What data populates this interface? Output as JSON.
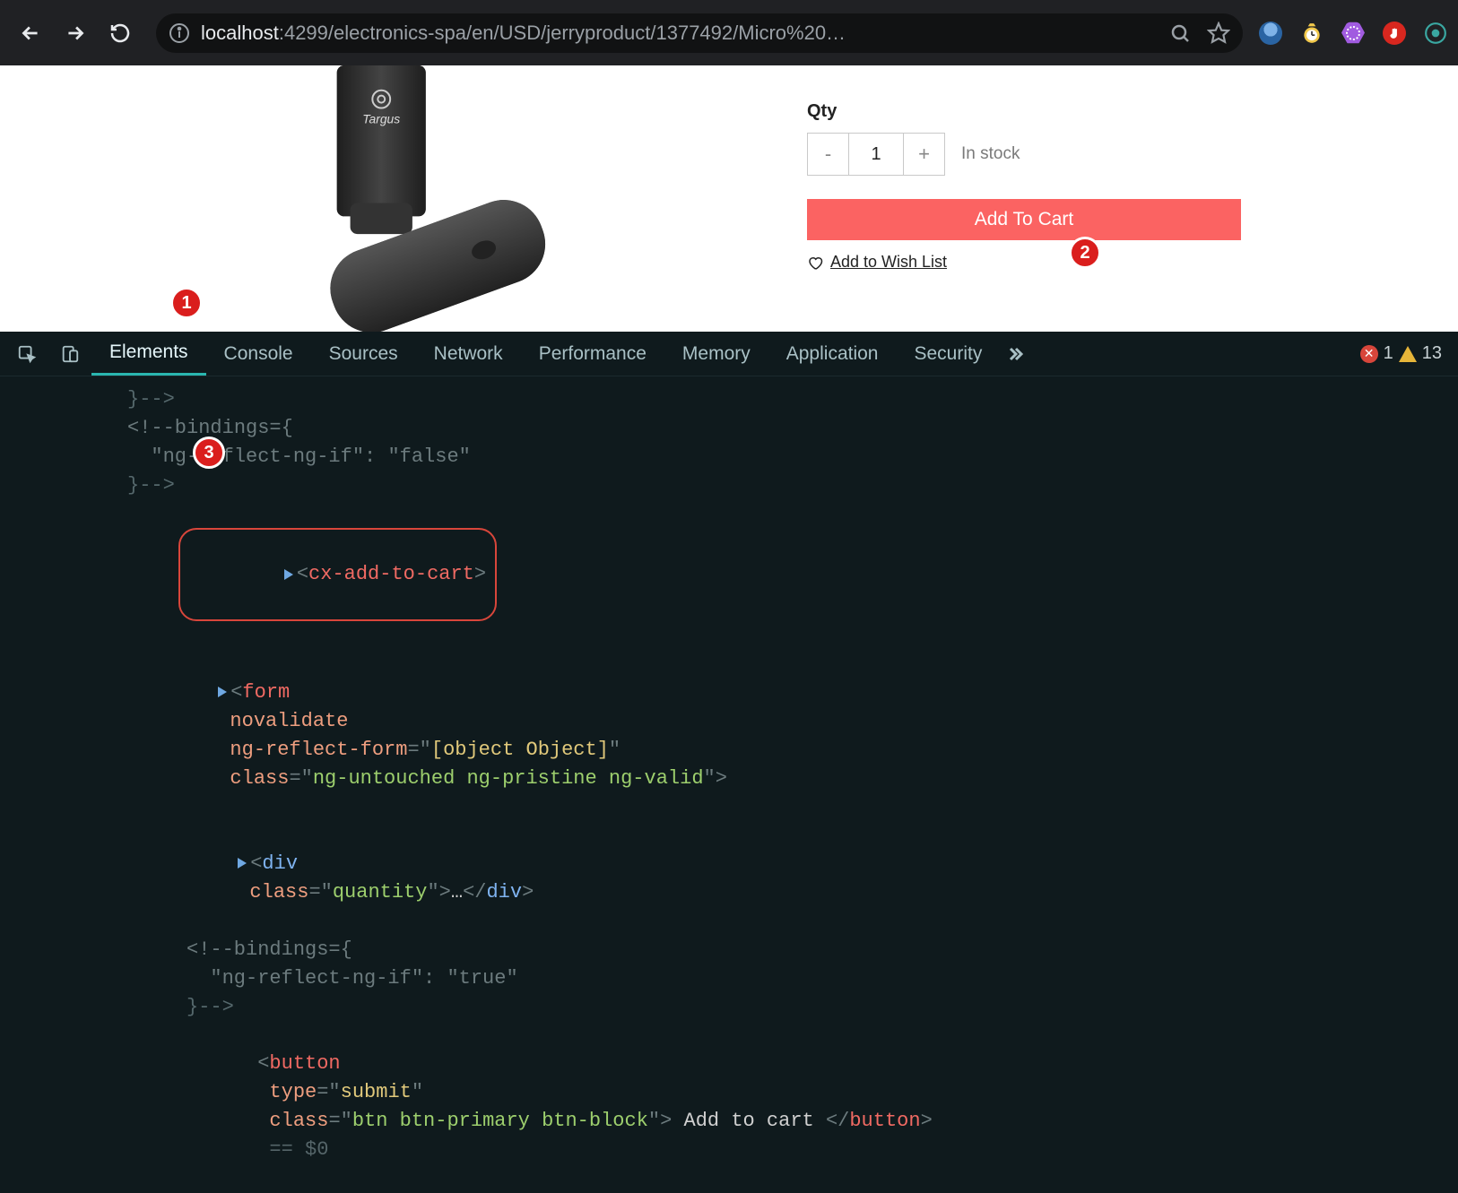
{
  "browser": {
    "url_host": "localhost",
    "url_rest": ":4299/electronics-spa/en/USD/jerryproduct/1377492/Micro%20…"
  },
  "product": {
    "brand": "Targus",
    "qty_label": "Qty",
    "qty_value": "1",
    "stock_text": "In stock",
    "add_to_cart": "Add To Cart",
    "wishlist": "Add to Wish List"
  },
  "devtools": {
    "tabs": [
      "Elements",
      "Console",
      "Sources",
      "Network",
      "Performance",
      "Memory",
      "Application",
      "Security"
    ],
    "errors": "1",
    "warnings": "13",
    "code": {
      "l0": "}-->",
      "l1": "<!--bindings={",
      "l2": "  \"ng-reflect-ng-if\": \"false\"",
      "l3": "}-->",
      "sel_tag": "cx-add-to-cart",
      "form_tag": "form",
      "form_attr1": "novalidate",
      "form_attr2": "ng-reflect-form",
      "form_val2": "[object Object]",
      "form_attr3": "class",
      "form_val3": "ng-untouched ng-pristine ng-valid",
      "div_tag": "div",
      "div_attr": "class",
      "div_val": "quantity",
      "div_ellipsis": "…",
      "l4": "<!--bindings={",
      "l5": "  \"ng-reflect-ng-if\": \"true\"",
      "l6": "}-->",
      "btn_tag": "button",
      "btn_attr1": "type",
      "btn_val1": "submit",
      "btn_attr2": "class",
      "btn_val2": "btn btn-primary btn-block",
      "btn_text": " Add to cart ",
      "eqref": "== $0"
    }
  },
  "badges": {
    "b1": "1",
    "b2": "2",
    "b3": "3"
  }
}
